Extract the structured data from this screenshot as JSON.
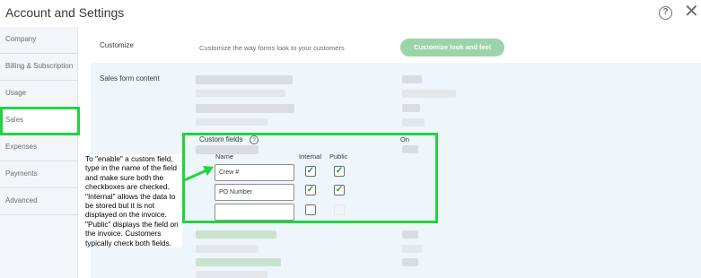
{
  "header": {
    "title": "Account and Settings",
    "help_glyph": "?",
    "close_glyph": "✕"
  },
  "sidebar": {
    "items": [
      {
        "label": "Company"
      },
      {
        "label": "Billing & Subscription"
      },
      {
        "label": "Usage"
      },
      {
        "label": "Sales"
      },
      {
        "label": "Expenses"
      },
      {
        "label": "Payments"
      },
      {
        "label": "Advanced"
      }
    ],
    "active": "Sales"
  },
  "customize": {
    "label": "Customize",
    "description": "Customize the way forms look to your customers",
    "button_label": "Customize look and feel"
  },
  "sales_form": {
    "label": "Sales form content",
    "custom_fields": {
      "label": "Custom fields",
      "help_glyph": "?",
      "status": "On",
      "col_name": "Name",
      "col_internal": "Internal",
      "col_public": "Public",
      "rows": [
        {
          "name": "Crew #",
          "internal": true,
          "public": true
        },
        {
          "name": "PO Number",
          "internal": true,
          "public": true
        },
        {
          "name": "",
          "internal": false,
          "public": false
        }
      ]
    }
  },
  "annotation": {
    "text": "To \"enable\" a custom field, type in the name of the field and make sure both the checkboxes are checked. \"Internal\" allows the data to be stored but it is not displayed on the invoice. \"Public\" displays the field on the invoice. Customers typically check both fields.",
    "highlight_color": "#22d33f"
  },
  "colors": {
    "accent_green": "#2ca01c",
    "button_green": "#9bd4a8",
    "panel_bg": "#eef5fb"
  }
}
